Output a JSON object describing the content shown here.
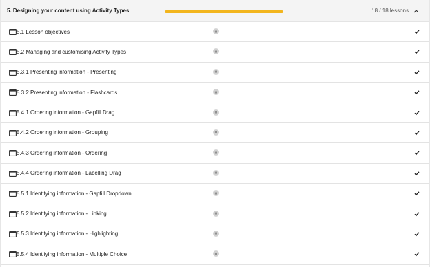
{
  "section": {
    "title": "5. Designing your content using Activity Types",
    "progress_fraction": 1.0,
    "lesson_count": "18 / 18 lessons",
    "toggle_icon": "chevron-up-icon",
    "accent_color": "#f2b51d"
  },
  "lessons": [
    {
      "label": "5.1 Lesson objectives",
      "icon": "window-icon",
      "status": "completed"
    },
    {
      "label": "5.2 Managing and customising Activity Types",
      "icon": "window-icon",
      "status": "completed"
    },
    {
      "label": "5.3.1 Presenting information - Presenting",
      "icon": "window-icon",
      "status": "completed"
    },
    {
      "label": "5.3.2 Presenting information - Flashcards",
      "icon": "window-icon",
      "status": "completed"
    },
    {
      "label": "5.4.1 Ordering information - Gapfill Drag",
      "icon": "window-icon",
      "status": "completed"
    },
    {
      "label": "5.4.2 Ordering information - Grouping",
      "icon": "window-icon",
      "status": "completed"
    },
    {
      "label": "5.4.3 Ordering information - Ordering",
      "icon": "window-icon",
      "status": "completed"
    },
    {
      "label": "5.4.4 Ordering information - Labelling Drag",
      "icon": "window-icon",
      "status": "completed"
    },
    {
      "label": "5.5.1 Identifying information - Gapfill Dropdown",
      "icon": "window-icon",
      "status": "completed"
    },
    {
      "label": "5.5.2 Identifying information - Linking",
      "icon": "window-icon",
      "status": "completed"
    },
    {
      "label": "5.5.3 Identifying information - Highlighting",
      "icon": "window-icon",
      "status": "completed"
    },
    {
      "label": "5.5.4 Identifying information - Multiple Choice",
      "icon": "window-icon",
      "status": "completed"
    }
  ]
}
